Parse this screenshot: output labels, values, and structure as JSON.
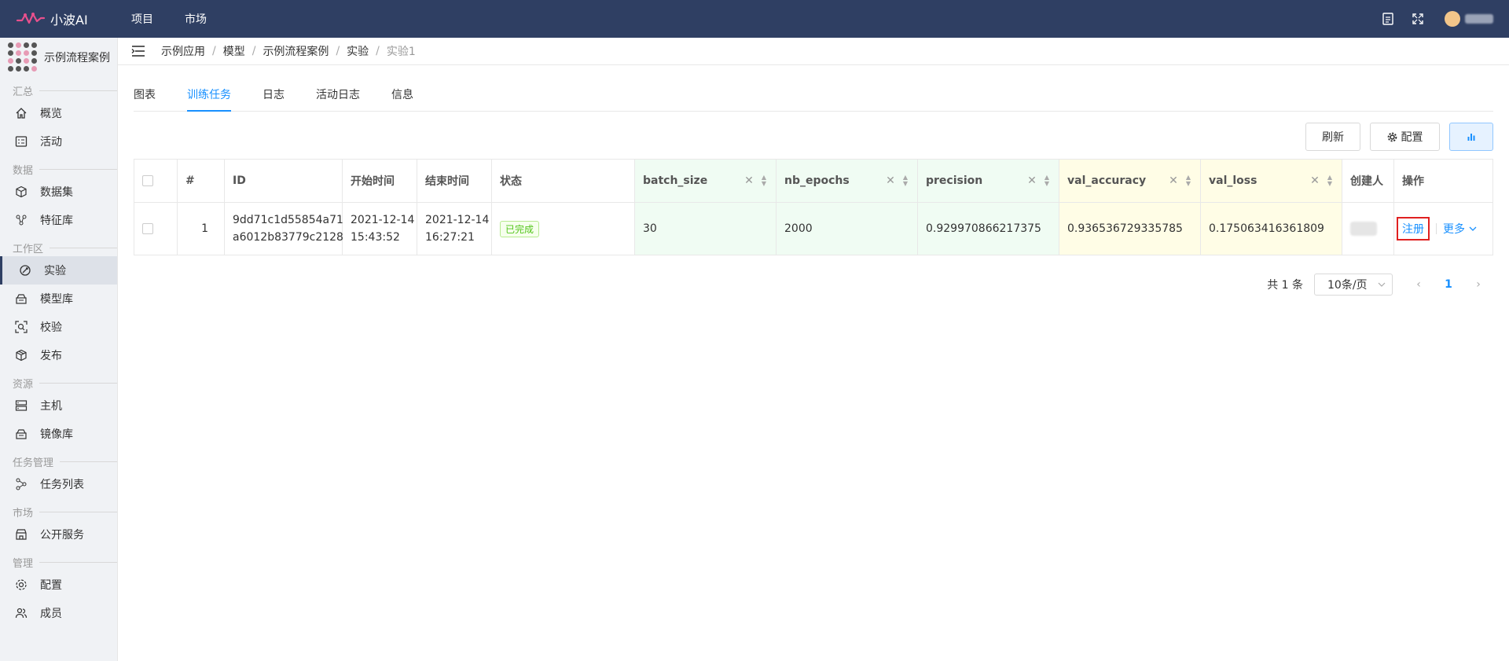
{
  "topbar": {
    "brand": "小波AI",
    "nav": [
      "项目",
      "市场"
    ],
    "icons": [
      "document-icon",
      "fullscreen-icon"
    ],
    "brand_color": "#2f3f63"
  },
  "sidebar": {
    "project_name": "示例流程案例",
    "groups": [
      {
        "title": "汇总",
        "items": [
          {
            "label": "概览",
            "icon": "home-icon"
          },
          {
            "label": "活动",
            "icon": "activity-icon"
          }
        ]
      },
      {
        "title": "数据",
        "items": [
          {
            "label": "数据集",
            "icon": "cube-icon"
          },
          {
            "label": "特征库",
            "icon": "feature-icon"
          }
        ]
      },
      {
        "title": "工作区",
        "items": [
          {
            "label": "实验",
            "icon": "experiment-icon",
            "active": true
          },
          {
            "label": "模型库",
            "icon": "model-icon"
          },
          {
            "label": "校验",
            "icon": "scan-icon"
          },
          {
            "label": "发布",
            "icon": "package-icon"
          }
        ]
      },
      {
        "title": "资源",
        "items": [
          {
            "label": "主机",
            "icon": "server-icon"
          },
          {
            "label": "镜像库",
            "icon": "image-repo-icon"
          }
        ]
      },
      {
        "title": "任务管理",
        "items": [
          {
            "label": "任务列表",
            "icon": "share-icon"
          }
        ]
      },
      {
        "title": "市场",
        "items": [
          {
            "label": "公开服务",
            "icon": "store-icon"
          }
        ]
      },
      {
        "title": "管理",
        "items": [
          {
            "label": "配置",
            "icon": "gear-icon"
          },
          {
            "label": "成员",
            "icon": "users-icon"
          }
        ]
      }
    ]
  },
  "breadcrumb": [
    "示例应用",
    "模型",
    "示例流程案例",
    "实验",
    "实验1"
  ],
  "tabs": [
    {
      "label": "图表",
      "active": false
    },
    {
      "label": "训练任务",
      "active": true
    },
    {
      "label": "日志",
      "active": false
    },
    {
      "label": "活动日志",
      "active": false
    },
    {
      "label": "信息",
      "active": false
    }
  ],
  "toolbar": {
    "refresh": "刷新",
    "config": "配置"
  },
  "table": {
    "columns": [
      "#",
      "ID",
      "开始时间",
      "结束时间",
      "状态",
      "batch_size",
      "nb_epochs",
      "precision",
      "val_accuracy",
      "val_loss",
      "创建人",
      "操作"
    ],
    "rows": [
      {
        "index": "1",
        "id_line1": "9dd71c1d55854a71",
        "id_line2": "a6012b83779c2128",
        "start_date": "2021-12-14",
        "start_time": "15:43:52",
        "end_date": "2021-12-14",
        "end_time": "16:27:21",
        "status": "已完成",
        "batch_size": "30",
        "nb_epochs": "2000",
        "precision": "0.929970866217375",
        "val_accuracy": "0.936536729335785",
        "val_loss": "0.175063416361809",
        "action_register": "注册",
        "action_more": "更多"
      }
    ]
  },
  "pagination": {
    "total": "共 1 条",
    "page_size": "10条/页",
    "current": "1"
  }
}
